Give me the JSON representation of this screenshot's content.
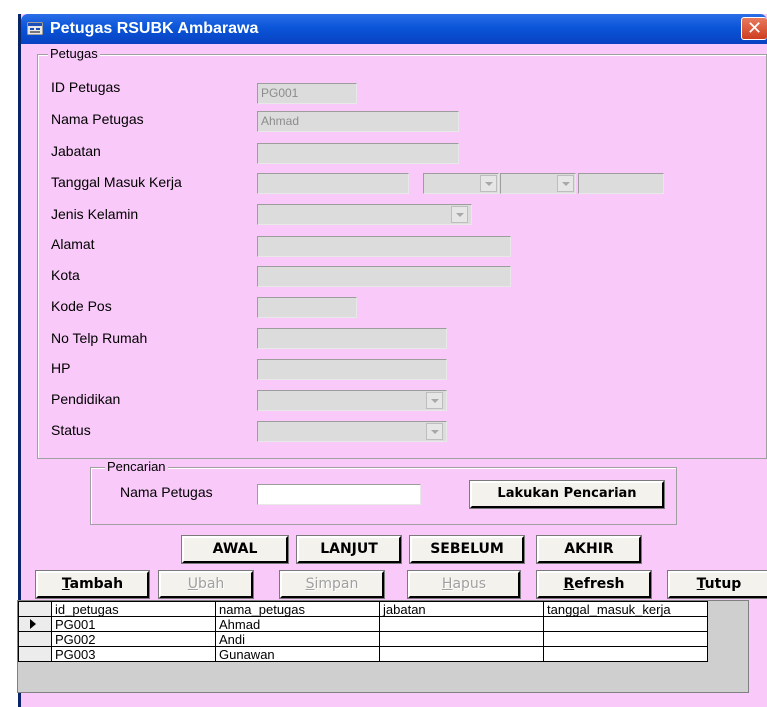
{
  "window": {
    "title": "Petugas RSUBK Ambarawa",
    "close_glyph": "✕"
  },
  "petugas_group": {
    "legend": "Petugas",
    "fields": {
      "id_petugas": {
        "label": "ID Petugas",
        "value": "PG001"
      },
      "nama_petugas": {
        "label": "Nama Petugas",
        "value": "Ahmad"
      },
      "jabatan": {
        "label": "Jabatan",
        "value": ""
      },
      "tanggal_masuk_kerja": {
        "label": "Tanggal Masuk Kerja",
        "value": ""
      },
      "jenis_kelamin": {
        "label": "Jenis Kelamin",
        "value": ""
      },
      "alamat": {
        "label": "Alamat",
        "value": ""
      },
      "kota": {
        "label": "Kota",
        "value": ""
      },
      "kode_pos": {
        "label": "Kode Pos",
        "value": ""
      },
      "no_telp_rumah": {
        "label": "No Telp Rumah",
        "value": ""
      },
      "hp": {
        "label": "HP",
        "value": ""
      },
      "pendidikan": {
        "label": "Pendidikan",
        "value": ""
      },
      "status": {
        "label": "Status",
        "value": ""
      }
    }
  },
  "search_group": {
    "legend": "Pencarian",
    "label": "Nama Petugas",
    "value": "",
    "button": "Lakukan Pencarian"
  },
  "navigation": {
    "first": "AWAL",
    "next": "LANJUT",
    "previous": "SEBELUM",
    "last": "AKHIR"
  },
  "actions": {
    "tambah": {
      "hotkey": "T",
      "rest": "ambah"
    },
    "ubah": {
      "hotkey": "U",
      "rest": "bah"
    },
    "simpan": {
      "hotkey": "S",
      "rest": "impan"
    },
    "hapus": {
      "hotkey": "H",
      "rest": "apus"
    },
    "refresh": {
      "hotkey": "R",
      "rest": "efresh"
    },
    "tutup": {
      "hotkey": "T",
      "rest": "utup"
    }
  },
  "grid": {
    "columns": [
      "id_petugas",
      "nama_petugas",
      "jabatan",
      "tanggal_masuk_kerja"
    ],
    "rows": [
      {
        "id_petugas": "PG001",
        "nama_petugas": "Ahmad",
        "jabatan": "",
        "tanggal_masuk_kerja": "",
        "current": true
      },
      {
        "id_petugas": "PG002",
        "nama_petugas": "Andi",
        "jabatan": "",
        "tanggal_masuk_kerja": "",
        "current": false
      },
      {
        "id_petugas": "PG003",
        "nama_petugas": "Gunawan",
        "jabatan": "",
        "tanggal_masuk_kerja": "",
        "current": false
      }
    ]
  },
  "colors": {
    "form_background": "#f9c9f9",
    "titlebar": "#0a55d8",
    "disabled_field": "#dcdcdc"
  }
}
